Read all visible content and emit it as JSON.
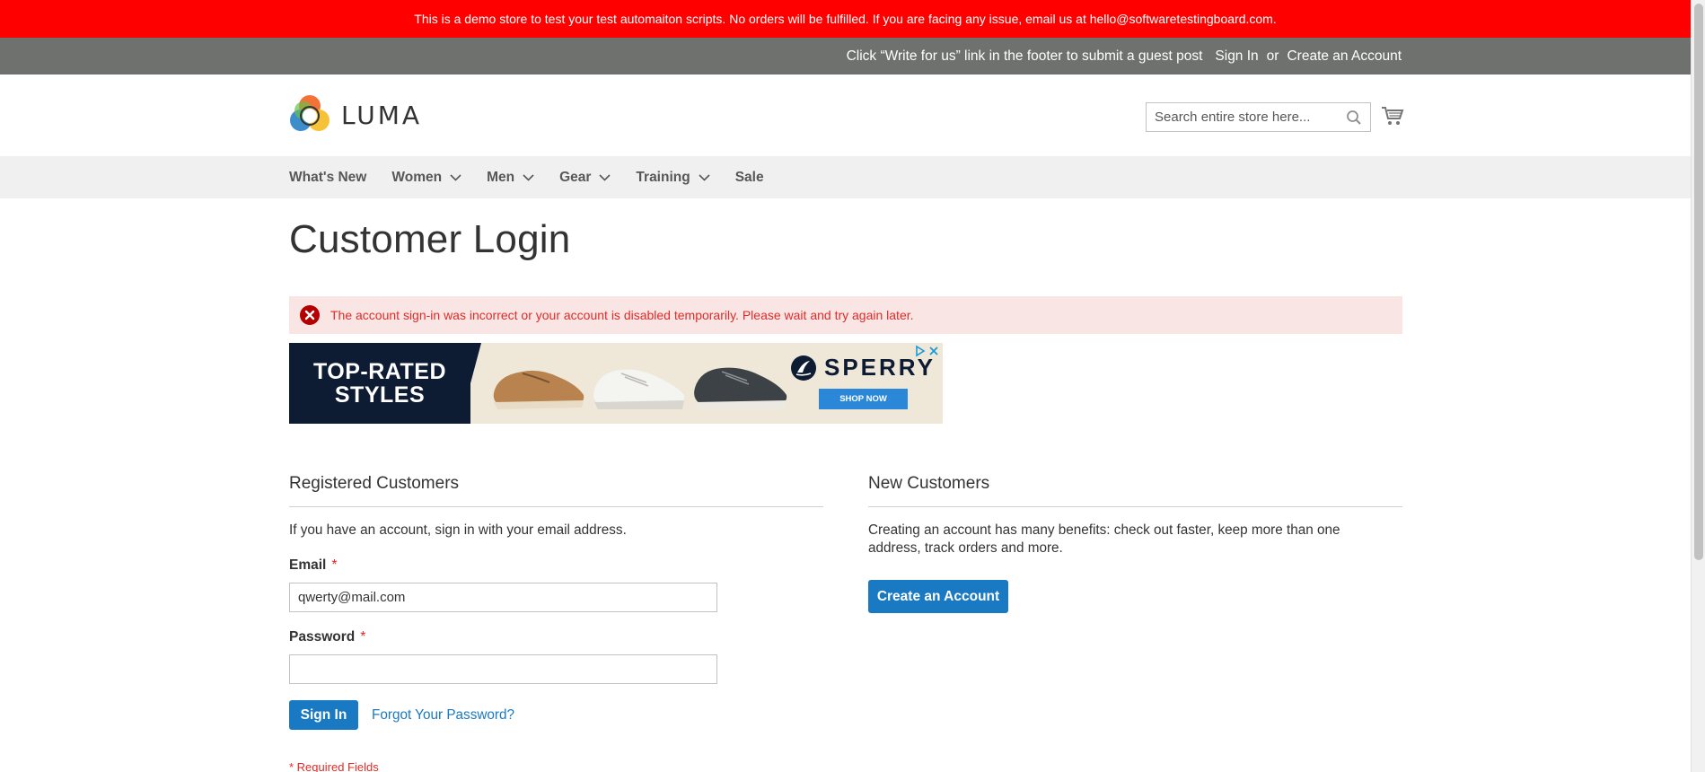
{
  "demo_notice": "This is a demo store to test your test automaiton scripts. No orders will be fulfilled. If you are facing any issue, email us at hello@softwaretestingboard.com.",
  "panel": {
    "promo": "Click “Write for us” link in the footer to submit a guest post",
    "sign_in": "Sign In",
    "or": "or",
    "create_account": "Create an Account"
  },
  "header": {
    "logo_text": "LUMA",
    "search_placeholder": "Search entire store here...",
    "search_value": ""
  },
  "nav": {
    "items": [
      {
        "label": "What's New",
        "dropdown": false
      },
      {
        "label": "Women",
        "dropdown": true
      },
      {
        "label": "Men",
        "dropdown": true
      },
      {
        "label": "Gear",
        "dropdown": true
      },
      {
        "label": "Training",
        "dropdown": true
      },
      {
        "label": "Sale",
        "dropdown": false
      }
    ]
  },
  "page_title": "Customer Login",
  "error_message": "The account sign-in was incorrect or your account is disabled temporarily. Please wait and try again later.",
  "ad": {
    "headline_1": "TOP-RATED",
    "headline_2": "STYLES",
    "brand": "SPERRY",
    "cta": "SHOP NOW"
  },
  "registered": {
    "title": "Registered Customers",
    "intro": "If you have an account, sign in with your email address.",
    "email_label": "Email",
    "email_value": "qwerty@mail.com",
    "password_label": "Password",
    "password_value": "",
    "required_mark": "*",
    "sign_in_button": "Sign In",
    "forgot_link": "Forgot Your Password?",
    "required_note": "* Required Fields"
  },
  "new_customers": {
    "title": "New Customers",
    "text": "Creating an account has many benefits: check out faster, keep more than one address, track orders and more.",
    "create_button": "Create an Account"
  },
  "colors": {
    "demo_bar": "#ff0000",
    "panel_bar": "#6e716e",
    "nav_bg": "#f0f0f0",
    "primary": "#1979c3",
    "error_bg": "#fae5e5",
    "error_text": "#e02b27"
  }
}
